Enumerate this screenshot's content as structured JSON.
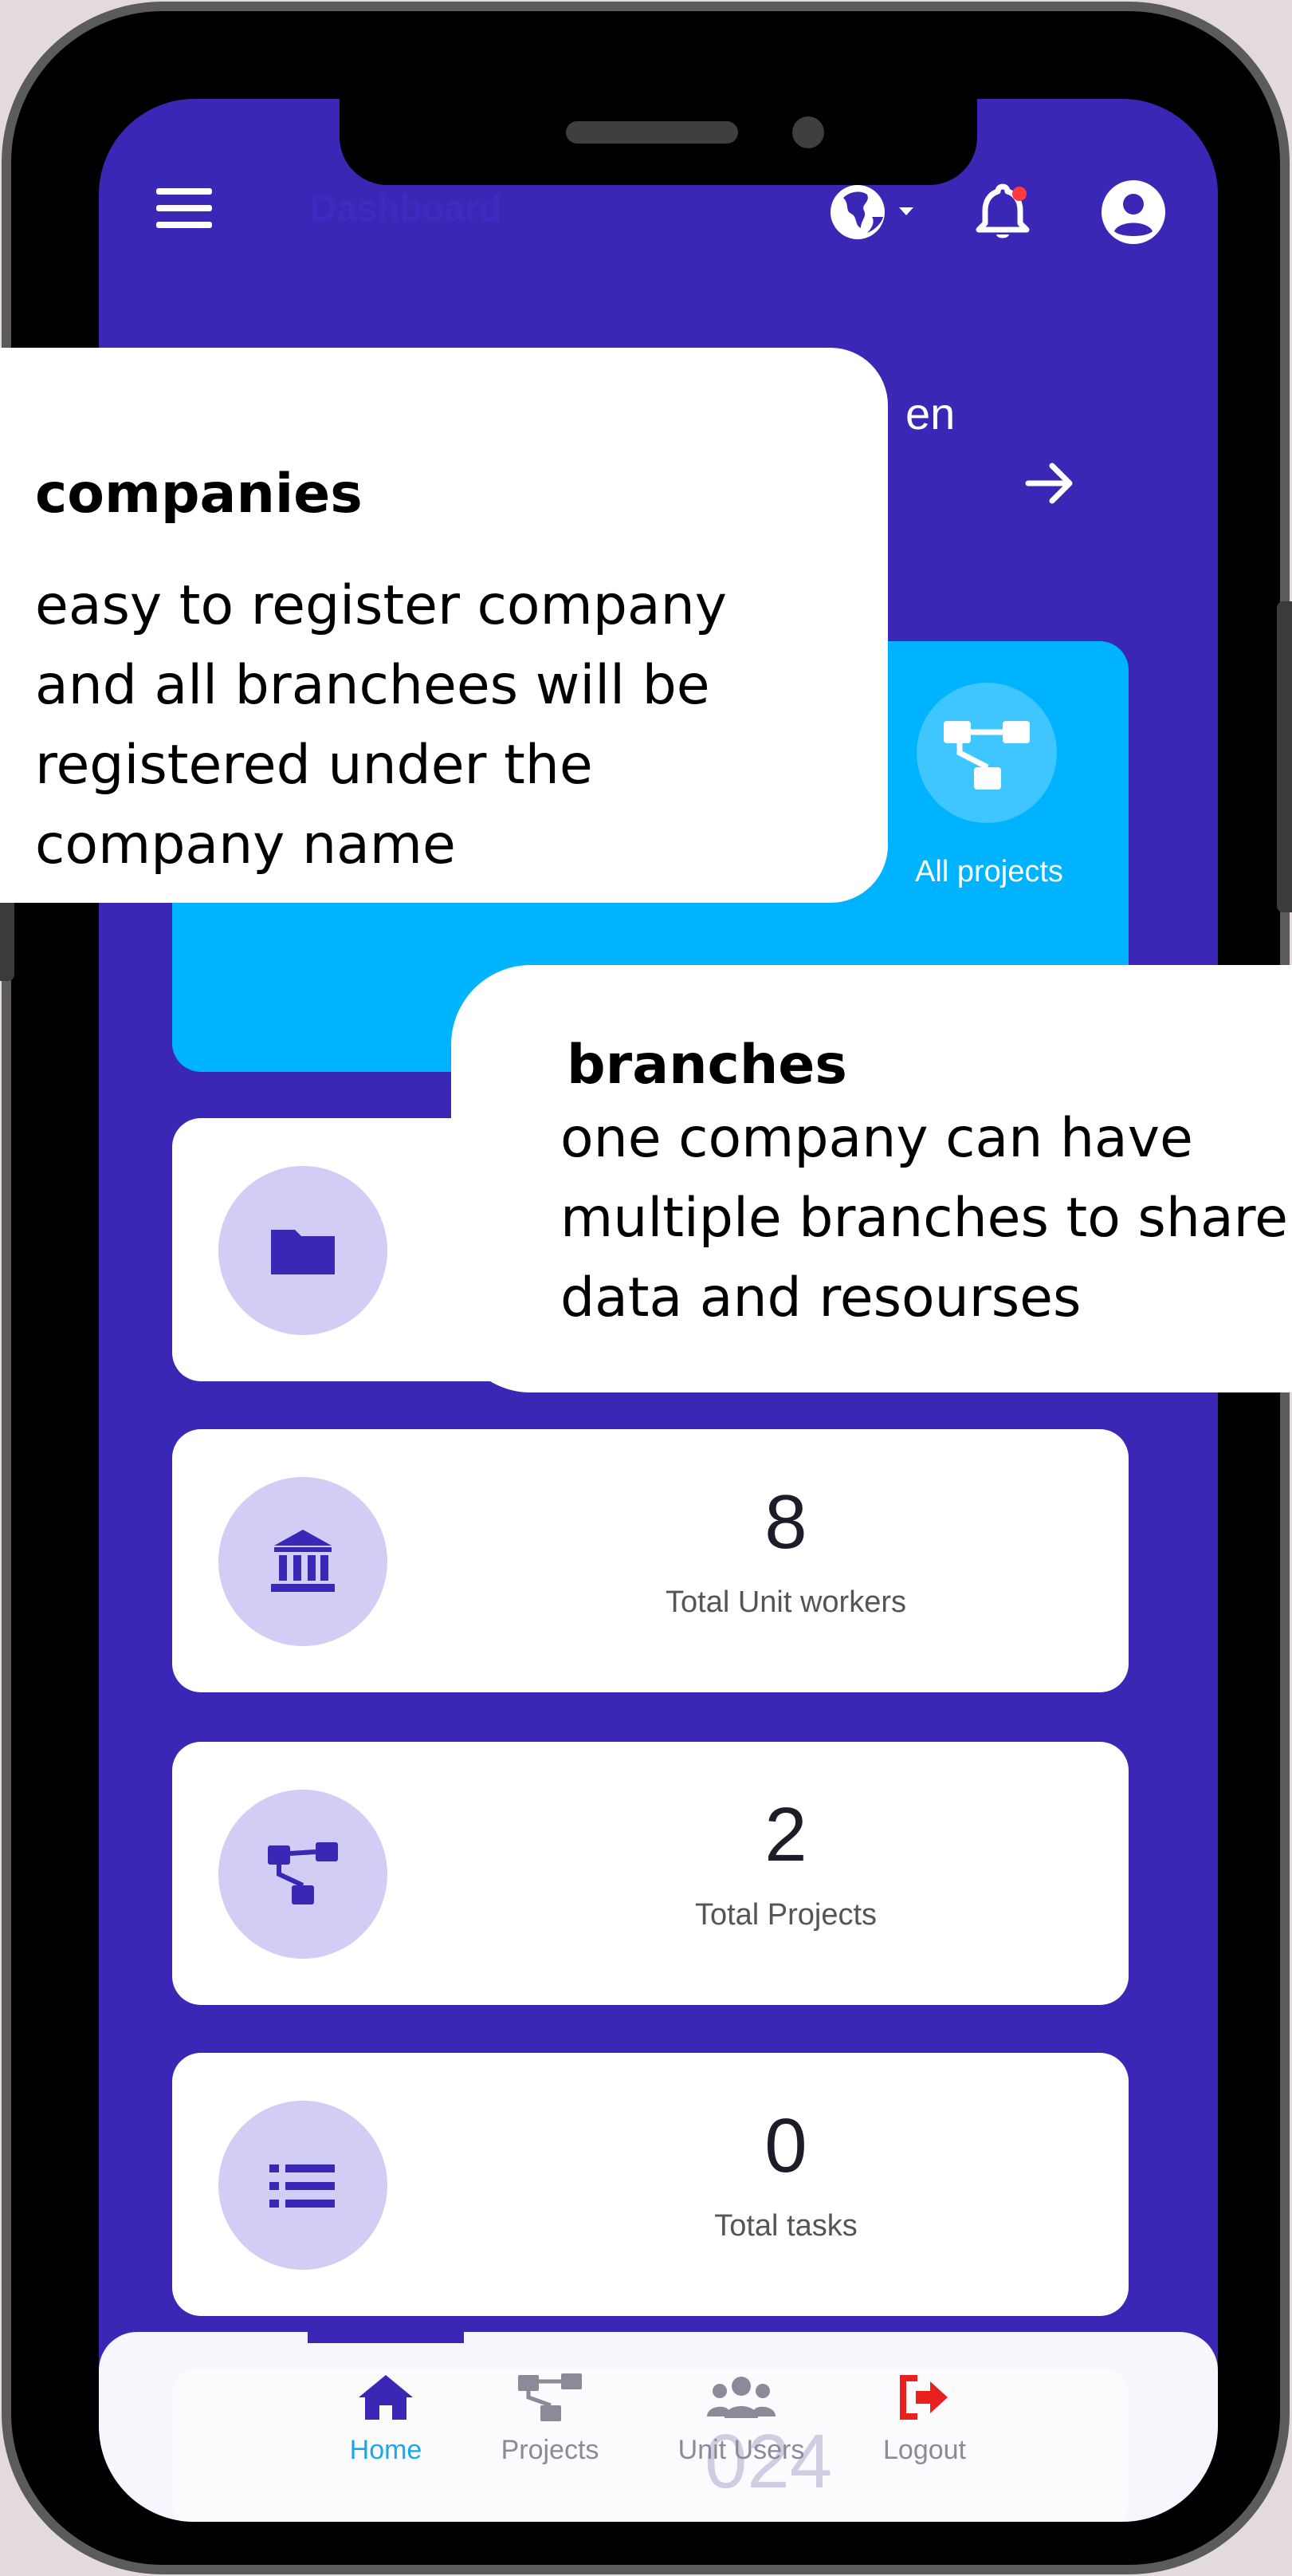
{
  "header": {
    "title": "Dashboard",
    "menu_icon": "hamburger-menu-icon",
    "language_icon": "globe-icon",
    "notification_icon": "bell-icon",
    "profile_icon": "user-circle-icon"
  },
  "partial_heading": "en",
  "hero_card": {
    "label": "All projects",
    "icon": "project-tree-icon"
  },
  "stats": [
    {
      "value": "8",
      "label": "Total Unit workers",
      "icon": "bank-icon"
    },
    {
      "value": "2",
      "label": "Total Projects",
      "icon": "project-tree-icon"
    },
    {
      "value": "0",
      "label": "Total tasks",
      "icon": "list-icon"
    }
  ],
  "hidden_card_value": "024",
  "bottom_nav": [
    {
      "label": "Home",
      "icon": "home-icon",
      "active": true
    },
    {
      "label": "Projects",
      "icon": "project-tree-icon",
      "active": false
    },
    {
      "label": "Unit Users",
      "icon": "users-icon",
      "active": false
    },
    {
      "label": "Logout",
      "icon": "logout-icon",
      "active": false
    }
  ],
  "callouts": {
    "companies": {
      "title": "companies",
      "lines": [
        "easy to register company",
        "and all branchees will be",
        "registered under the",
        "company name"
      ]
    },
    "branches": {
      "title": "branches",
      "lines": [
        "one company can have",
        "multiple branches to share",
        "data and resourses"
      ]
    }
  },
  "colors": {
    "screen_bg": "#3a27b6",
    "hero_bg": "#00b3ff",
    "icon_circle": "#d1cdf5",
    "icon_color": "#3a27b6",
    "active_nav": "#19a7f2",
    "logout": "#e8201e",
    "notification_dot": "#ff3b3b"
  }
}
